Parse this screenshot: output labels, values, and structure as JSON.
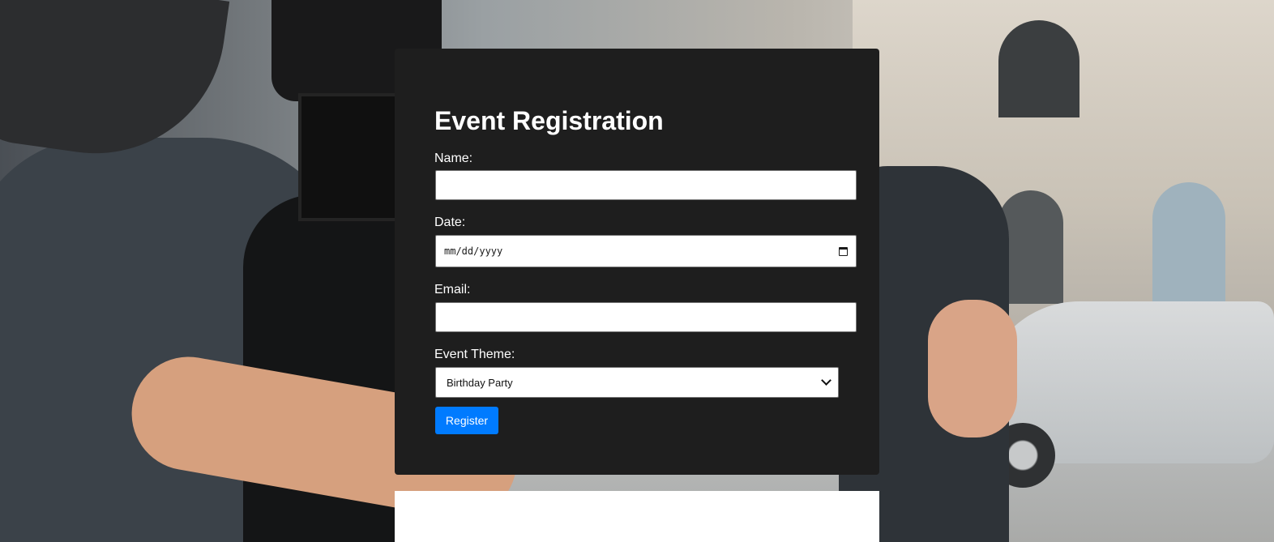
{
  "form": {
    "title": "Event Registration",
    "name_label": "Name:",
    "name_value": "",
    "date_label": "Date:",
    "date_placeholder": "mm/dd/yyyy",
    "email_label": "Email:",
    "email_value": "",
    "theme_label": "Event Theme:",
    "theme_selected": "Birthday Party",
    "register_label": "Register"
  },
  "colors": {
    "card_background": "#1e1e1e",
    "button_primary": "#007bff",
    "text": "#ffffff"
  },
  "icons": {
    "date_picker": "calendar-icon",
    "select": "chevron-down-icon"
  }
}
